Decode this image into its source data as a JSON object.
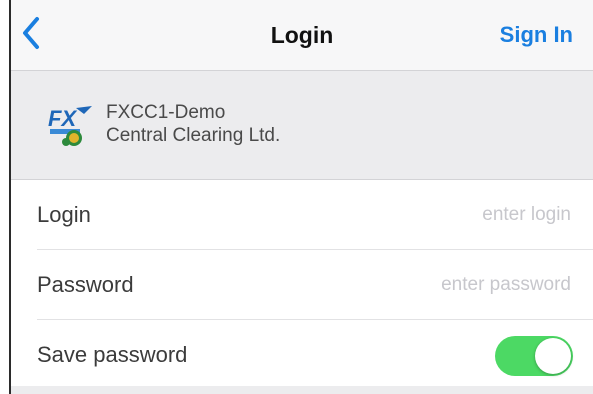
{
  "navbar": {
    "back_icon": "chevron-left-icon",
    "title": "Login",
    "sign_in_label": "Sign In",
    "accent_color": "#1a7fe0"
  },
  "server": {
    "logo_icon": "fxcc-logo",
    "name": "FXCC1-Demo",
    "company": "Central Clearing Ltd."
  },
  "form": {
    "login": {
      "label": "Login",
      "placeholder": "enter login",
      "value": ""
    },
    "password": {
      "label": "Password",
      "placeholder": "enter password",
      "value": ""
    },
    "save_password": {
      "label": "Save password",
      "enabled": true,
      "toggle_color": "#4cd964"
    }
  }
}
